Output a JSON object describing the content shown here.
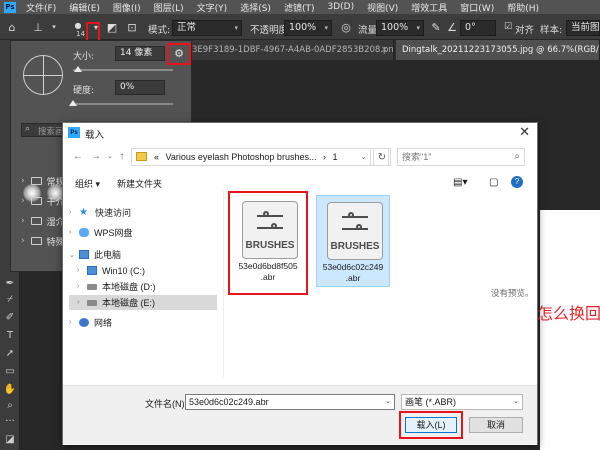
{
  "menubar": {
    "logo": "Ps",
    "items": [
      "文件(F)",
      "编辑(E)",
      "图像(I)",
      "图层(L)",
      "文字(Y)",
      "选择(S)",
      "滤镜(T)",
      "3D(D)",
      "视图(V)",
      "增效工具",
      "窗口(W)",
      "帮助(H)"
    ]
  },
  "options": {
    "brush_size_badge": "14",
    "mode_label": "模式:",
    "mode_value": "正常",
    "opacity_label": "不透明度:",
    "opacity_value": "100%",
    "flow_label": "流量:",
    "flow_value": "100%",
    "angle_value": "0°",
    "align_label": "对齐",
    "sample_label": "样本:",
    "sample_value": "当前图层"
  },
  "tabs": [
    {
      "label": "3E9F3189-1DBF-4967-A4AB-0ADF2853B208.png",
      "active": false
    },
    {
      "label": "Dingtalk_20211223173055.jpg @ 66.7%(RGB/8#) *",
      "active": true
    }
  ],
  "brush_picker": {
    "size_label": "大小:",
    "size_value": "14 像素",
    "hardness_label": "硬度:",
    "hardness_value": "0%",
    "size_fraction": 0.05,
    "hardness_fraction": 0.0,
    "search_placeholder": "搜索画...",
    "groups": [
      "常规画...",
      "干介...",
      "湿介...",
      "特殊..."
    ]
  },
  "canvas": {
    "text": "怎么换回"
  },
  "dialog": {
    "title": "载入",
    "breadcrumb_prefix": "«",
    "breadcrumb_folder": "Various eyelash Photoshop brushes...",
    "breadcrumb_sep": "›",
    "breadcrumb_current": "1",
    "search_placeholder": "搜索\"1\"",
    "organize": "组织 ▾",
    "new_folder": "新建文件夹",
    "nav": [
      {
        "label": "快速访问",
        "icon": "star-icon",
        "chevron": "›"
      },
      {
        "label": "WPS网盘",
        "icon": "cloud-icon",
        "chevron": "›"
      },
      {
        "label": "此电脑",
        "icon": "computer-icon",
        "chevron": "⌄"
      },
      {
        "label": "Win10 (C:)",
        "icon": "windows-drive-icon",
        "chevron": "›"
      },
      {
        "label": "本地磁盘 (D:)",
        "icon": "drive-icon",
        "chevron": "›"
      },
      {
        "label": "本地磁盘 (E:)",
        "icon": "drive-icon",
        "chevron": "›"
      },
      {
        "label": "网络",
        "icon": "network-icon",
        "chevron": "›"
      }
    ],
    "files": [
      {
        "icon_text": "BRUSHES",
        "name_line1": "53e0d6bd8f505",
        "name_line2": ".abr",
        "selected": false
      },
      {
        "icon_text": "BRUSHES",
        "name_line1": "53e0d6c02c249",
        "name_line2": ".abr",
        "selected": true
      }
    ],
    "no_preview": "没有预览。",
    "filename_label": "文件名(N):",
    "filename_value": "53e0d6c02c249.abr",
    "filetype_value": "画笔 (*.ABR)",
    "load_button": "载入(L)",
    "cancel_button": "取消"
  }
}
